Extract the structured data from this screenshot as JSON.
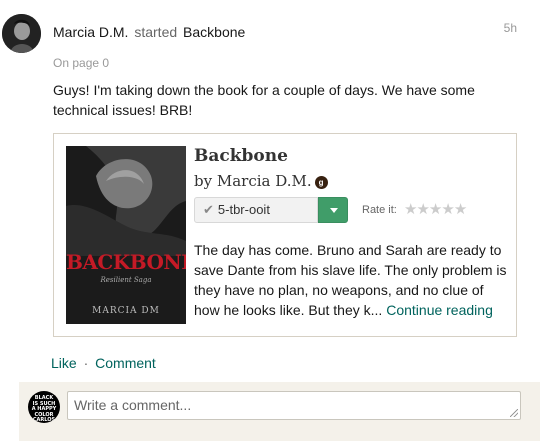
{
  "post": {
    "author": "Marcia D.M.",
    "verb": "started",
    "book": "Backbone",
    "time": "5h",
    "page": "On page 0",
    "message": "Guys! I'm taking down the book for a couple of days. We have some technical issues! BRB!"
  },
  "book_card": {
    "title": "Backbone",
    "by": "by Marcia D.M.",
    "badge_icon": "goodreads-author-icon",
    "shelf": "5-tbr-ooit",
    "shelf_color": "#409d69",
    "rate_label": "Rate it:",
    "rating_stars": 5,
    "rating_value": 0,
    "description": "The day has come. Bruno and Sarah are ready to save Dante from his slave life. The only problem is they have no plan, no weapons, and no clue of how he looks like. But they k...",
    "continue_label": "Continue reading",
    "cover": {
      "title": "BACKBONE",
      "subtitle": "Resilient Saga",
      "author": "MARCIA DM",
      "title_color": "#c41a26"
    }
  },
  "actions": {
    "like": "Like",
    "separator": "·",
    "comment": "Comment",
    "link_color": "#00635d"
  },
  "comment_box": {
    "placeholder": "Write a comment...",
    "avatar_text": "BLACK IS SUCH A HAPPY COLOR CARLOS"
  }
}
